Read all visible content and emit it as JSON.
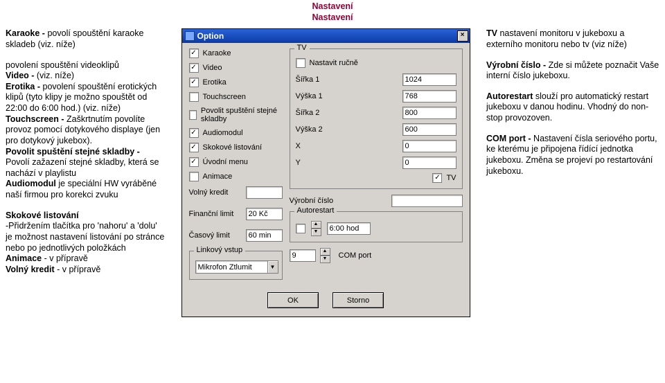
{
  "title": "Nastavení",
  "left": {
    "p1": "Karaoke - povolí spouštění karaoke skladeb (viz. níže)",
    "p2": "povolení spouštění videoklipů Video - (viz. níže)\nErotika - povolení spouštění erotických klipů (tyto klipy je možno spouštět od 22:00 do 6:00 hod.) (viz. níže)\nTouchscreen - Zaškrtnutím povolíte provoz pomocí dotykového displaye (jen pro dotykový jukebox).\nPovolit spuštění stejné skladby - Povolí zažazení stejné skladby, která se nachází v playlistu\nAudiomodul je speciální HW vyráběné naší firmou pro korekci zvuku",
    "p3": "Skokové listování\n-Přidržením tlačítka pro 'nahoru' a 'dolu' je možnost nastavení listování po stránce nebo po jednotlivých položkách\nAnimace - v přípravě\nVolný kredit - v přípravě"
  },
  "right": {
    "p1": "TV nastavení monitoru v jukeboxu a externího monitoru nebo tv (viz níže)",
    "p2": "Výrobní číslo - Zde si můžete poznačit Vaše interní číslo jukeboxu.",
    "p3": "Autorestart slouží pro automatický restart jukeboxu v danou hodinu. Vhodný do non-stop provozoven.",
    "p4": "COM port - Nastavení čísla seriového portu, ke kterému je připojena řídící jednotka jukeboxu. Změna se projeví po restartování jukeboxu."
  },
  "dlg": {
    "caption": "Option",
    "left_checks": [
      {
        "label": "Karaoke",
        "checked": true
      },
      {
        "label": "Video",
        "checked": true
      },
      {
        "label": "Erotika",
        "checked": true
      },
      {
        "label": "Touchscreen",
        "checked": false
      },
      {
        "label": "Povolit spuštění stejné skladby",
        "checked": false
      },
      {
        "label": "Audiomodul",
        "checked": true
      },
      {
        "label": "Skokové listování",
        "checked": true
      },
      {
        "label": "Úvodní menu",
        "checked": true
      },
      {
        "label": "Animace",
        "checked": false
      }
    ],
    "left_fields": [
      {
        "label": "Volný kredit",
        "value": ""
      },
      {
        "label": "Finanční limit",
        "value": "20 Kč"
      },
      {
        "label": "Časový limit",
        "value": "60 min"
      }
    ],
    "linkov": {
      "legend": "Linkový vstup",
      "value": "Mikrofon Ztlumit"
    },
    "tv": {
      "legend": "TV",
      "manual": {
        "label": "Nastavit ručně",
        "checked": false
      },
      "rows": [
        {
          "label": "Šířka 1",
          "value": "1024"
        },
        {
          "label": "Výška 1",
          "value": "768"
        },
        {
          "label": "Šířka 2",
          "value": "800"
        },
        {
          "label": "Výška 2",
          "value": "600"
        },
        {
          "label": "X",
          "value": "0"
        },
        {
          "label": "Y",
          "value": "0"
        }
      ],
      "tv_check": {
        "label": "TV",
        "checked": true
      }
    },
    "vyrobni": {
      "label": "Výrobní číslo",
      "value": ""
    },
    "autorestart": {
      "legend": "Autorestart",
      "value": "6:00 hod",
      "checked": false
    },
    "com": {
      "label": "COM port",
      "value": "9"
    },
    "btn_ok": "OK",
    "btn_cancel": "Storno"
  }
}
